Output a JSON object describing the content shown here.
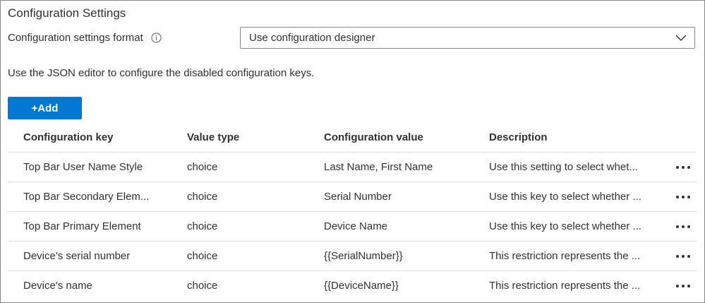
{
  "section": {
    "title": "Configuration Settings"
  },
  "format": {
    "label": "Configuration settings format",
    "info_icon": "info-icon",
    "selected_value": "Use configuration designer",
    "chevron_icon": "chevron-down-icon"
  },
  "helper_text": "Use the JSON editor to configure the disabled configuration keys.",
  "add_button": {
    "label": "+Add",
    "color": "#0078d4"
  },
  "table": {
    "headers": [
      "Configuration key",
      "Value type",
      "Configuration value",
      "Description"
    ],
    "rows": [
      {
        "key": "Top Bar User Name Style",
        "type": "choice",
        "value": "Last Name, First Name",
        "description": "Use this setting to select whet..."
      },
      {
        "key": "Top Bar Secondary Elem...",
        "type": "choice",
        "value": "Serial Number",
        "description": "Use this key to select whether ..."
      },
      {
        "key": "Top Bar Primary Element",
        "type": "choice",
        "value": "Device Name",
        "description": "Use this key to select whether ..."
      },
      {
        "key": "Device's serial number",
        "type": "choice",
        "value": "{{SerialNumber}}",
        "description": "This restriction represents the ..."
      },
      {
        "key": "Device's name",
        "type": "choice",
        "value": "{{DeviceName}}",
        "description": "This restriction represents the ..."
      }
    ],
    "row_action_icon": "more-icon"
  }
}
